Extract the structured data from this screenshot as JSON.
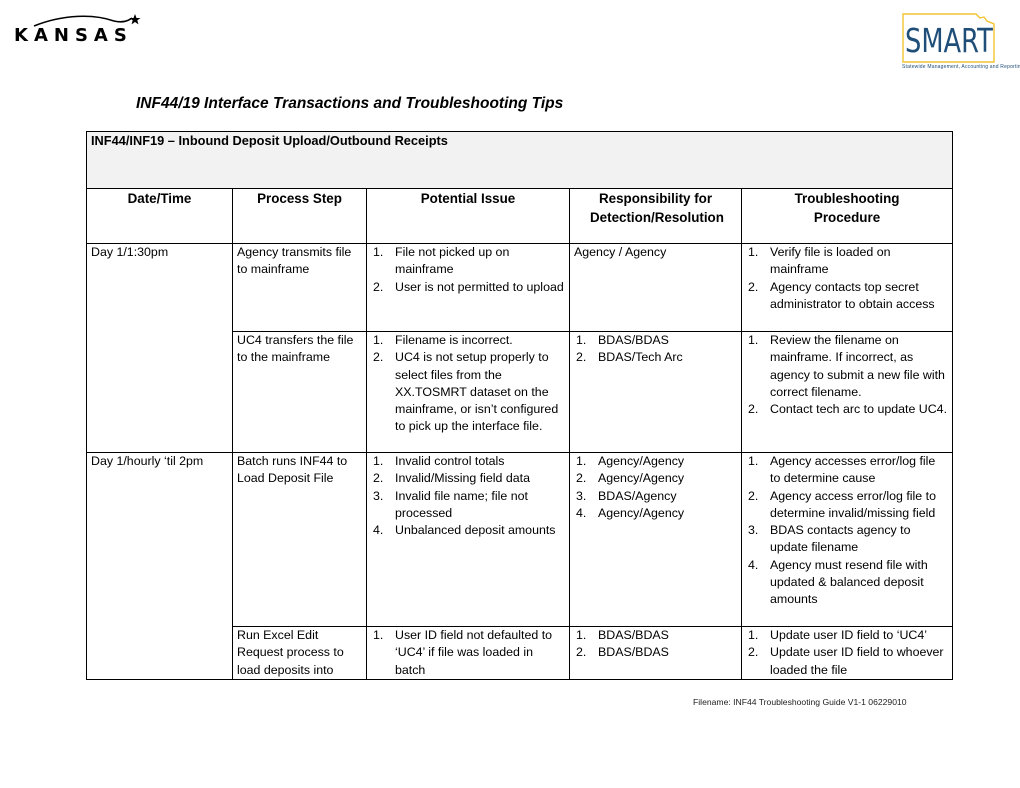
{
  "header": {
    "left_logo": {
      "name": "kansas-logo",
      "text": "KANSAS"
    },
    "right_logo": {
      "name": "smart-logo",
      "text": "SMART",
      "subtitle": "Statewide Management, Accounting and Reporting Tool",
      "colors": {
        "text": "#1f4e79",
        "outline": "#f2c431"
      }
    }
  },
  "document": {
    "title": "INF44/19 Interface Transactions and Troubleshooting Tips"
  },
  "table": {
    "section_title": "INF44/INF19 – Inbound Deposit Upload/Outbound Receipts",
    "columns": [
      "Date/Time",
      "Process Step",
      "Potential Issue",
      "Responsibility for Detection/Resolution",
      "Troubleshooting Procedure"
    ],
    "groups": [
      {
        "date_time": "Day 1/1:30pm",
        "rows": [
          {
            "process_step": "Agency transmits file to mainframe",
            "issues": [
              "File not picked up on mainframe",
              "User is not permitted to upload"
            ],
            "responsibility_plain": "Agency / Agency",
            "responsibility": [],
            "procedure": [
              "Verify file is loaded on mainframe",
              "Agency contacts top secret administrator to obtain access"
            ]
          },
          {
            "process_step": "UC4 transfers the file to the mainframe",
            "issues": [
              "Filename is incorrect.",
              "UC4 is not setup properly to select files from the XX.TOSMRT dataset on the mainframe, or isn’t configured to pick up the interface file."
            ],
            "responsibility_plain": "",
            "responsibility": [
              "BDAS/BDAS",
              "BDAS/Tech Arc"
            ],
            "procedure": [
              "Review the filename on mainframe. If incorrect, as agency to submit a new file with correct filename.",
              "Contact tech arc to update UC4."
            ]
          }
        ]
      },
      {
        "date_time": "Day 1/hourly ‘til 2pm",
        "rows": [
          {
            "process_step": "Batch runs INF44 to Load Deposit File",
            "issues": [
              "Invalid control totals",
              "Invalid/Missing field data",
              "Invalid file name; file not processed",
              "Unbalanced deposit amounts"
            ],
            "responsibility_plain": "",
            "responsibility": [
              "Agency/Agency",
              "Agency/Agency",
              "BDAS/Agency",
              "Agency/Agency"
            ],
            "procedure": [
              "Agency accesses error/log file to determine cause",
              "Agency access error/log file to determine invalid/missing field",
              "BDAS contacts agency to update filename",
              "Agency must resend file with updated & balanced deposit amounts"
            ]
          },
          {
            "process_step": "Run Excel Edit Request process  to load deposits into",
            "issues": [
              "User ID field not defaulted to ‘UC4’ if file was loaded in batch"
            ],
            "responsibility_plain": "",
            "responsibility": [
              "BDAS/BDAS",
              "BDAS/BDAS"
            ],
            "procedure": [
              "Update user ID field to ‘UC4’",
              "Update user ID field to whoever loaded the file"
            ]
          }
        ]
      }
    ]
  },
  "footer": {
    "filename": "Filename:  INF44 Troubleshooting Guide V1-1 06229010"
  }
}
